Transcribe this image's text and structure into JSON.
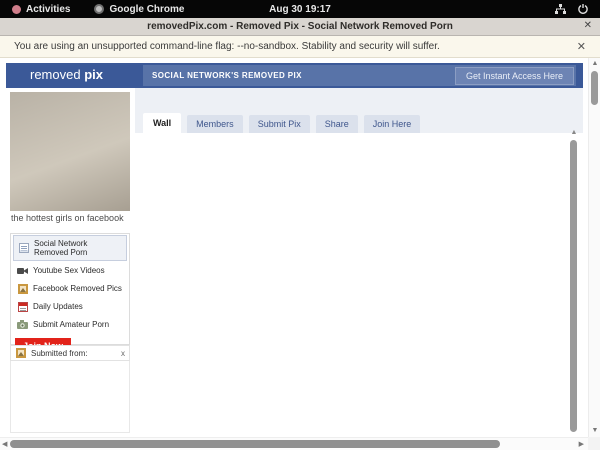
{
  "system_bar": {
    "activities_label": "Activities",
    "app_name": "Google Chrome",
    "clock": "Aug 30  19:17"
  },
  "window": {
    "title": "removedPix.com - Removed Pix - Social Network Removed Porn",
    "close_glyph": "✕"
  },
  "infobar": {
    "message": "You are using an unsupported command-line flag: --no-sandbox. Stability and security will suffer.",
    "close_glyph": "✕"
  },
  "header": {
    "logo_normal": "removed ",
    "logo_bold": "pix",
    "banner": "SOCIAL NETWORK'S REMOVED PIX",
    "cta_label": "Get Instant Access Here"
  },
  "profile": {
    "photo_caption": "the hottest girls on facebook"
  },
  "tabs": [
    {
      "label": "Wall",
      "active": true
    },
    {
      "label": "Members",
      "active": false
    },
    {
      "label": "Submit Pix",
      "active": false
    },
    {
      "label": "Share",
      "active": false
    },
    {
      "label": "Join Here",
      "active": false
    }
  ],
  "sidebar": {
    "items": [
      {
        "label": "Social Network Removed Porn",
        "icon": "note-icon",
        "selected": true
      },
      {
        "label": "Youtube Sex Videos",
        "icon": "video-icon",
        "selected": false
      },
      {
        "label": "Facebook Removed Pics",
        "icon": "photo-icon",
        "selected": false
      },
      {
        "label": "Daily Updates",
        "icon": "calendar-icon",
        "selected": false
      },
      {
        "label": "Submit Amateur Porn",
        "icon": "camera-icon",
        "selected": false
      }
    ],
    "join_button_label": "Join Now",
    "submitted_from_label": "Submitted from:",
    "submitted_close_glyph": "x"
  },
  "glyphs": {
    "arrow_up": "▲",
    "arrow_down": "▼",
    "arrow_left": "◀",
    "arrow_right": "▶"
  },
  "colors": {
    "header_blue": "#3b5998",
    "header_inner_blue": "#5873a8",
    "cta_blue": "#6d84b4",
    "join_red": "#e2231a",
    "infobar_cream": "#faf7ec",
    "tab_inactive": "#dbe1ec",
    "selected_item_bg": "#eef1f6",
    "topbar_black": "#060606"
  }
}
